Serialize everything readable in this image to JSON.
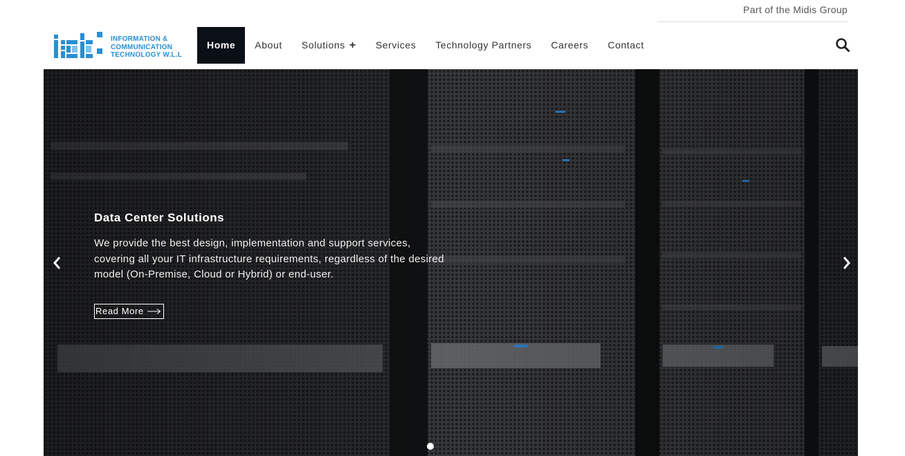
{
  "topbar": {
    "text": "Part of the Midis Group"
  },
  "logo": {
    "letters": "ict:",
    "line1": "INFORMATION &",
    "line2": "COMMUNICATION",
    "line3": "TECHNOLOGY W.L.L",
    "color": "#2a8fd3"
  },
  "nav": {
    "items": [
      {
        "label": "Home",
        "active": true
      },
      {
        "label": "About"
      },
      {
        "label": "Solutions",
        "suffix": "+"
      },
      {
        "label": "Services"
      },
      {
        "label": "Technology Partners"
      },
      {
        "label": "Careers"
      },
      {
        "label": "Contact"
      }
    ],
    "search_icon": "search-icon"
  },
  "hero": {
    "title": "Data Center Solutions",
    "description": "We provide the best design, implementation and support services, covering all your IT infrastructure requirements, regardless of the desired model (On-Premise, Cloud or Hybrid) or end-user.",
    "button_label": "Read More",
    "prev_icon": "chevron-left-icon",
    "next_icon": "chevron-right-icon",
    "slide_count": 1,
    "active_slide": 1
  }
}
